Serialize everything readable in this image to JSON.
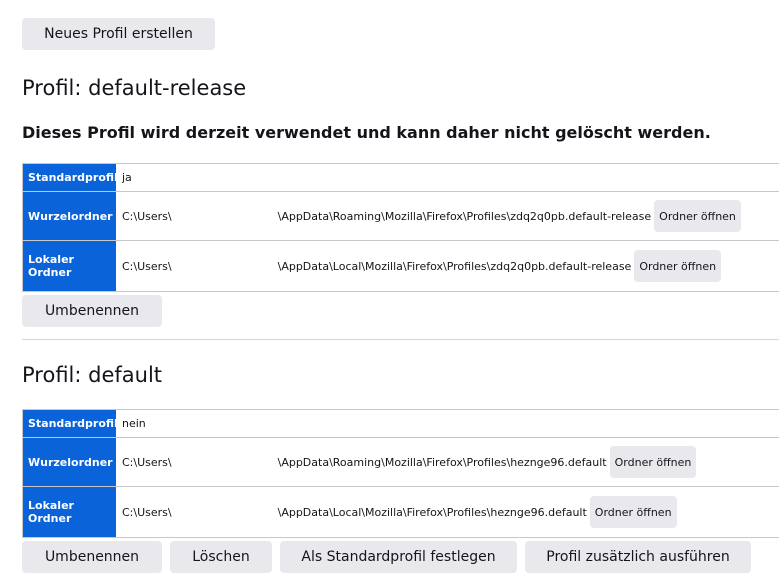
{
  "new_profile_button": "Neues Profil erstellen",
  "profiles": [
    {
      "title": "Profil: default-release",
      "note": "Dieses Profil wird derzeit verwendet und kann daher nicht gelöscht werden.",
      "default_label": "Standardprofil",
      "default_value": "ja",
      "root_label": "Wurzelordner",
      "root_prefix": "C:\\Users\\",
      "root_suffix": "\\AppData\\Roaming\\Mozilla\\Firefox\\Profiles\\zdq2q0pb.default-release",
      "local_label": "Lokaler Ordner",
      "local_prefix": "C:\\Users\\",
      "local_suffix": "\\AppData\\Local\\Mozilla\\Firefox\\Profiles\\zdq2q0pb.default-release",
      "open_folder": "Ordner öffnen",
      "rename": "Umbenennen"
    },
    {
      "title": "Profil: default",
      "default_label": "Standardprofil",
      "default_value": "nein",
      "root_label": "Wurzelordner",
      "root_prefix": "C:\\Users\\",
      "root_suffix": "\\AppData\\Roaming\\Mozilla\\Firefox\\Profiles\\hezngе96.default",
      "local_label": "Lokaler Ordner",
      "local_prefix": "C:\\Users\\",
      "local_suffix": "\\AppData\\Local\\Mozilla\\Firefox\\Profiles\\hezngе96.default",
      "open_folder": "Ordner öffnen",
      "rename": "Umbenennen",
      "delete": "Löschen",
      "set_default": "Als Standardprofil festlegen",
      "launch": "Profil zusätzlich ausführen"
    }
  ]
}
